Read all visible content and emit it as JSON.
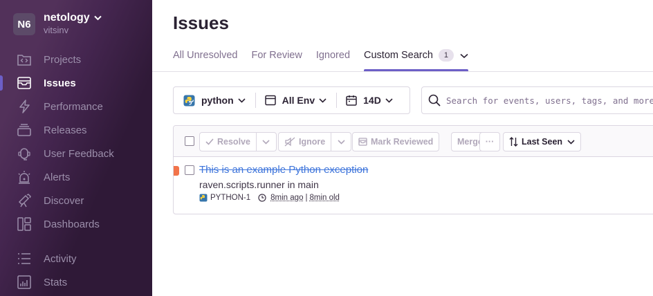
{
  "org": {
    "avatar": "N6",
    "name": "netology",
    "user": "vitsinv"
  },
  "sidebar": {
    "items": [
      {
        "label": "Projects",
        "icon": "projects-icon"
      },
      {
        "label": "Issues",
        "icon": "issues-icon",
        "active": true
      },
      {
        "label": "Performance",
        "icon": "performance-icon"
      },
      {
        "label": "Releases",
        "icon": "releases-icon"
      },
      {
        "label": "User Feedback",
        "icon": "user-feedback-icon"
      },
      {
        "label": "Alerts",
        "icon": "alerts-icon"
      },
      {
        "label": "Discover",
        "icon": "discover-icon"
      },
      {
        "label": "Dashboards",
        "icon": "dashboards-icon"
      },
      {
        "label": "Activity",
        "icon": "activity-icon"
      },
      {
        "label": "Stats",
        "icon": "stats-icon"
      }
    ]
  },
  "page": {
    "title": "Issues"
  },
  "tabs": [
    {
      "label": "All Unresolved"
    },
    {
      "label": "For Review"
    },
    {
      "label": "Ignored"
    },
    {
      "label": "Custom Search",
      "badge": "1",
      "active": true
    }
  ],
  "filters": {
    "project": "python",
    "environment": "All Env",
    "period": "14D"
  },
  "search": {
    "placeholder": "Search for events, users, tags, and more"
  },
  "actions": {
    "resolve": "Resolve",
    "ignore": "Ignore",
    "mark_reviewed": "Mark Reviewed",
    "merge": "Merge",
    "more": "···",
    "sort": "Last Seen"
  },
  "issue": {
    "title": "This is an example Python exception",
    "culprit": "raven.scripts.runner in main",
    "short_id": "PYTHON-1",
    "last_seen": "8min ago",
    "first_seen": "8min old",
    "level_color": "#f2744a"
  },
  "colors": {
    "accent": "#6c5fc7",
    "link": "#3d74db"
  }
}
